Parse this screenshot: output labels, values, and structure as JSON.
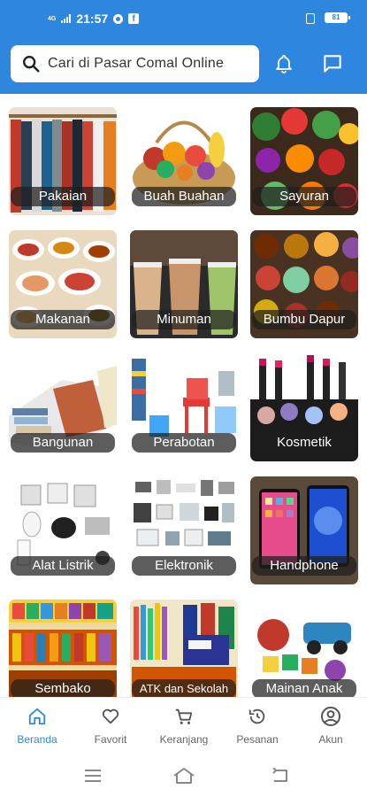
{
  "status_bar": {
    "network": "4G",
    "time": "21:57",
    "battery": "81",
    "icons": [
      "signal-icon",
      "notification-dot-icon",
      "facebook-icon",
      "vibrate-icon",
      "battery-icon"
    ]
  },
  "header": {
    "search_placeholder": "Cari di Pasar Comal Online",
    "icons": [
      "search-icon",
      "bell-icon",
      "chat-icon"
    ],
    "accent": "#2e86df"
  },
  "categories": [
    {
      "label": "Pakaian"
    },
    {
      "label": "Buah Buahan"
    },
    {
      "label": "Sayuran"
    },
    {
      "label": "Makanan"
    },
    {
      "label": "Minuman"
    },
    {
      "label": "Bumbu Dapur"
    },
    {
      "label": "Bangunan"
    },
    {
      "label": "Perabotan"
    },
    {
      "label": "Kosmetik"
    },
    {
      "label": "Alat Listrik"
    },
    {
      "label": "Elektronik"
    },
    {
      "label": "Handphone"
    },
    {
      "label": "Sembako"
    },
    {
      "label": "ATK dan Sekolah"
    },
    {
      "label": "Mainan Anak"
    }
  ],
  "bottom_nav": {
    "active": "Beranda",
    "items": [
      {
        "label": "Beranda",
        "icon": "home-icon"
      },
      {
        "label": "Favorit",
        "icon": "heart-icon"
      },
      {
        "label": "Keranjang",
        "icon": "cart-icon"
      },
      {
        "label": "Pesanan",
        "icon": "history-icon"
      },
      {
        "label": "Akun",
        "icon": "account-icon"
      }
    ]
  },
  "system_nav": {
    "icons": [
      "menu-icon",
      "home-outline-icon",
      "back-icon"
    ]
  }
}
